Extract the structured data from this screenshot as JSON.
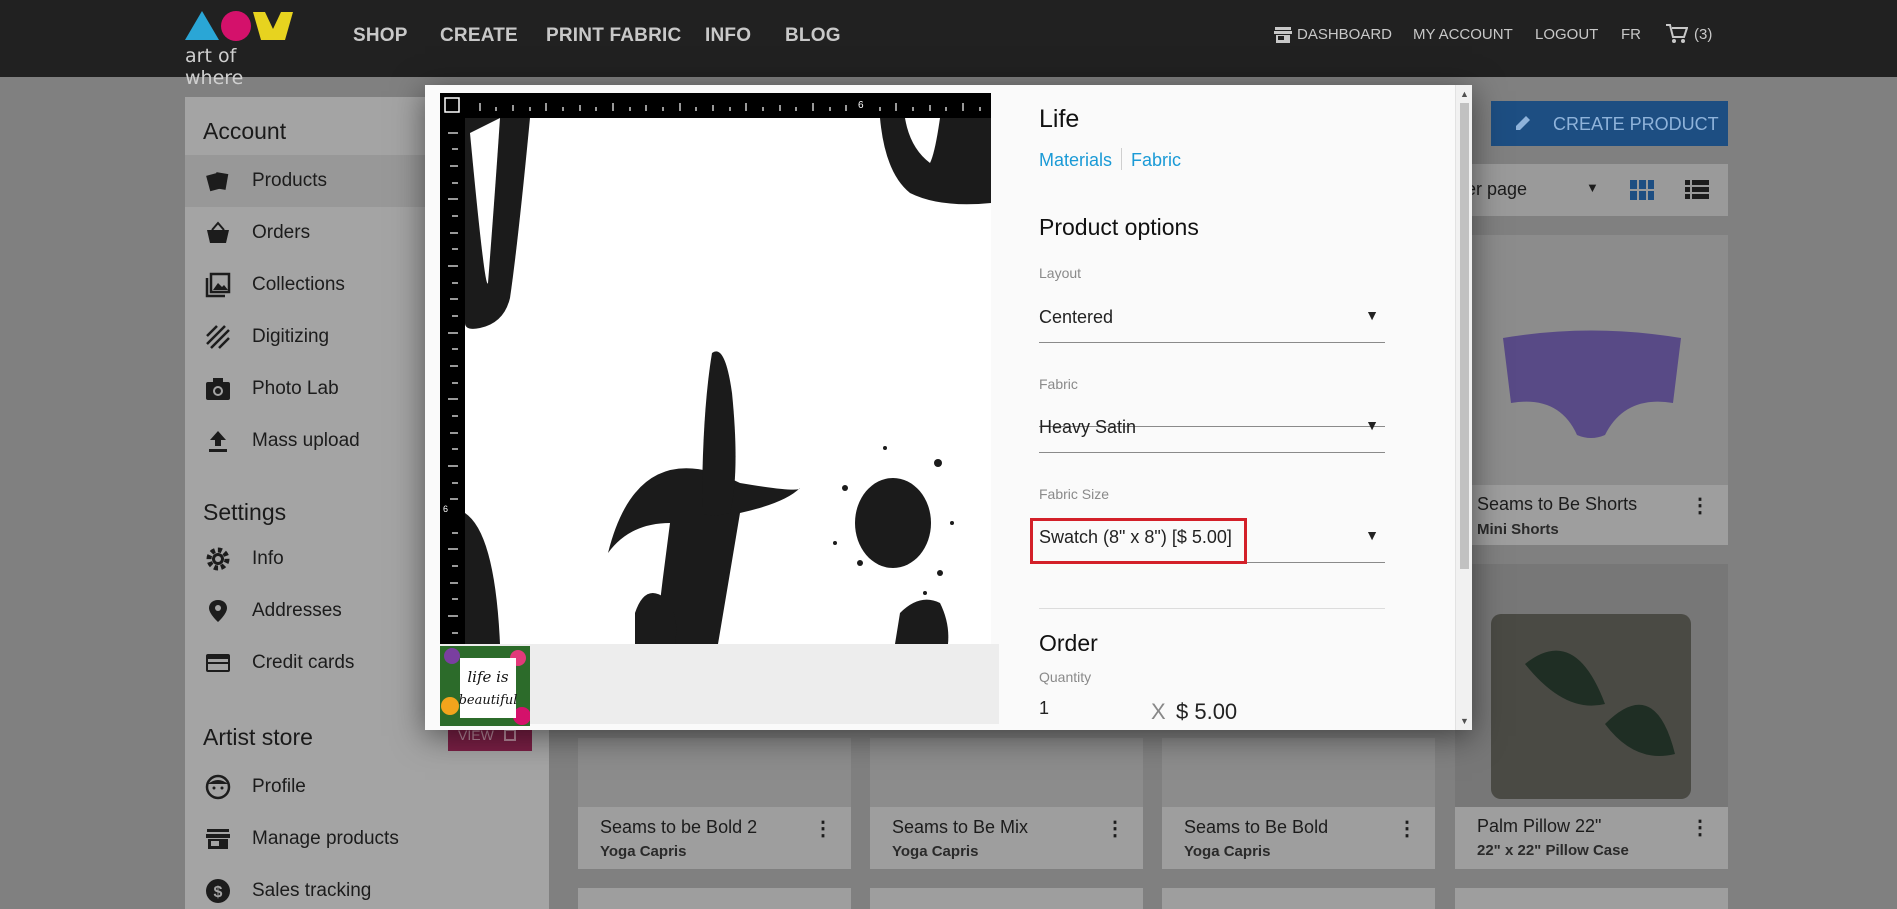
{
  "brand": {
    "name": "art of where",
    "colors": [
      "#2aa6d6",
      "#d4116b",
      "#e7d31f"
    ]
  },
  "nav": {
    "items": [
      "SHOP",
      "CREATE",
      "PRINT FABRIC",
      "INFO",
      "BLOG"
    ],
    "right": {
      "dashboard": "DASHBOARD",
      "account": "MY ACCOUNT",
      "logout": "LOGOUT",
      "lang": "FR",
      "cart_count": "(3)"
    }
  },
  "sidebar": {
    "account_heading": "Account",
    "account_items": [
      {
        "label": "Products",
        "icon": "products-icon"
      },
      {
        "label": "Orders",
        "icon": "basket-icon"
      },
      {
        "label": "Collections",
        "icon": "collections-icon"
      },
      {
        "label": "Digitizing",
        "icon": "digitizing-icon"
      },
      {
        "label": "Photo Lab",
        "icon": "camera-icon"
      },
      {
        "label": "Mass upload",
        "icon": "upload-icon"
      }
    ],
    "settings_heading": "Settings",
    "settings_items": [
      {
        "label": "Info",
        "icon": "gear-icon"
      },
      {
        "label": "Addresses",
        "icon": "location-pin-icon"
      },
      {
        "label": "Credit cards",
        "icon": "credit-card-icon"
      }
    ],
    "store_heading": "Artist store",
    "store_view": "VIEW",
    "store_items": [
      {
        "label": "Profile",
        "icon": "face-icon"
      },
      {
        "label": "Manage products",
        "icon": "store-icon"
      },
      {
        "label": "Sales tracking",
        "icon": "dollar-icon"
      }
    ]
  },
  "main": {
    "create_button": "CREATE PRODUCT",
    "per_page": "per page",
    "cards": [
      {
        "title": "Seams to Be Shorts",
        "subtitle": "Mini Shorts"
      },
      {
        "title": "Seams to be Bold 2",
        "subtitle": "Yoga Capris"
      },
      {
        "title": "Seams to Be Mix",
        "subtitle": "Yoga Capris"
      },
      {
        "title": "Seams to Be Bold",
        "subtitle": "Yoga Capris"
      },
      {
        "title": "Palm Pillow 22\"",
        "subtitle": "22\" x 22\" Pillow Case"
      }
    ]
  },
  "modal": {
    "title": "Life",
    "breadcrumbs": [
      "Materials",
      "Fabric"
    ],
    "options_heading": "Product options",
    "layout": {
      "label": "Layout",
      "value": "Centered"
    },
    "fabric": {
      "label": "Fabric",
      "value": "Heavy Satin"
    },
    "fabric_size": {
      "label": "Fabric Size",
      "value": "Swatch (8\" x 8\") [$ 5.00]"
    },
    "order_heading": "Order",
    "quantity": {
      "label": "Quantity",
      "value": "1"
    },
    "times": "X",
    "price": "$ 5.00",
    "ruler": {
      "top_mark": "6",
      "left_mark": "6"
    },
    "thumbnail_text": "life is beautiful"
  }
}
